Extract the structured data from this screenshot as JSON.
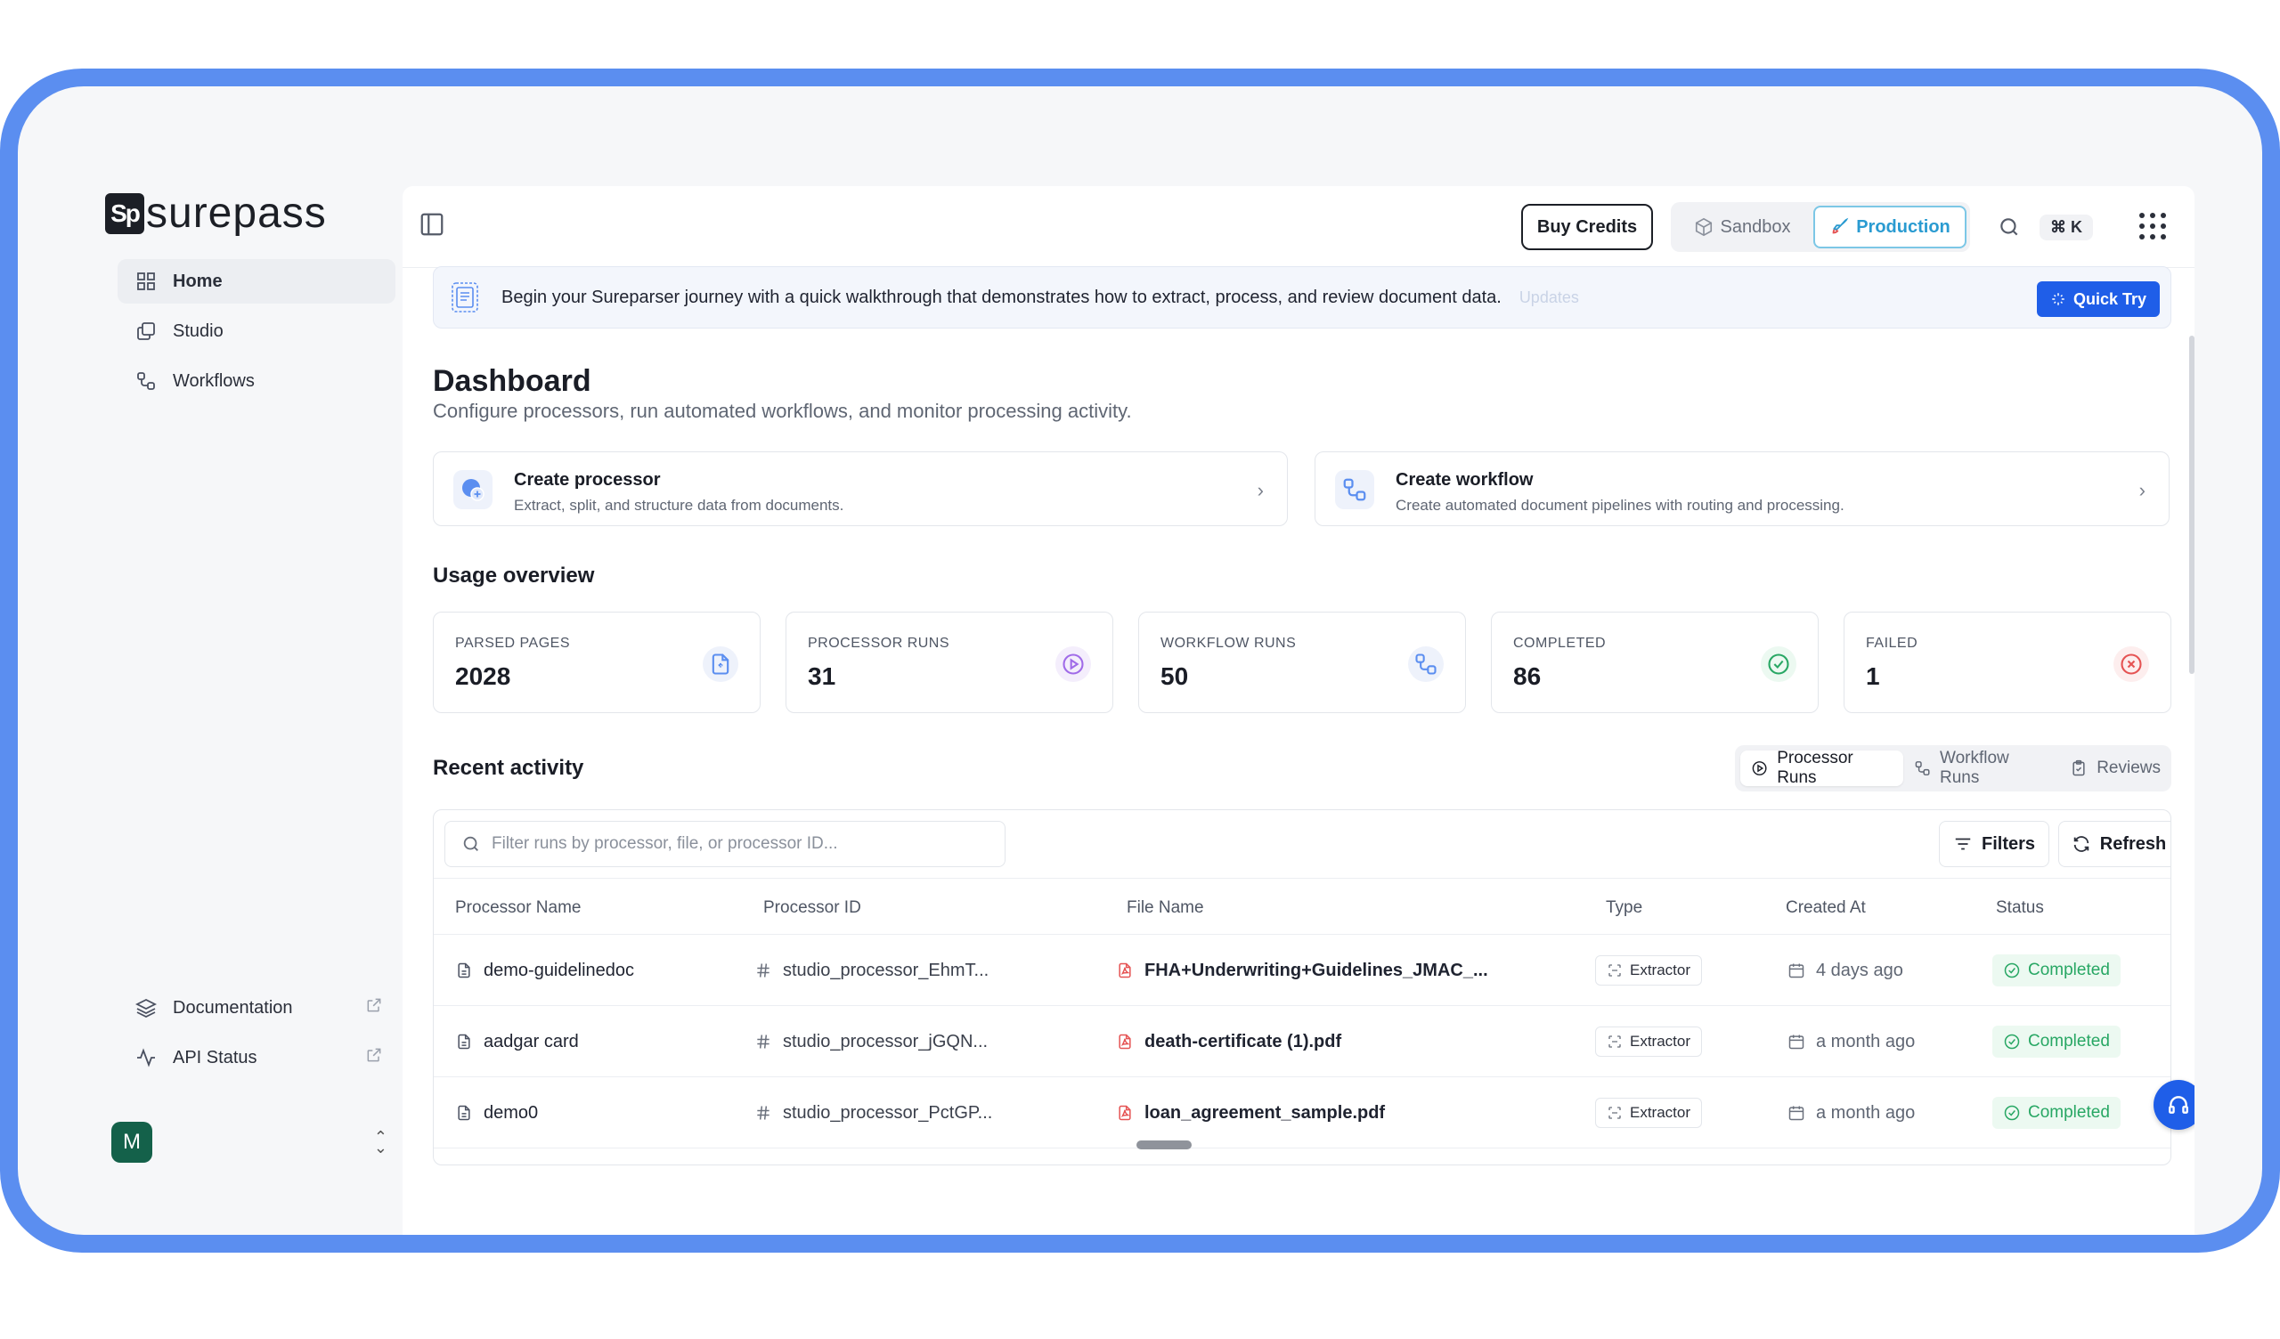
{
  "brand": {
    "mark": "Sp",
    "name": "surepass"
  },
  "sidebar": {
    "items": [
      {
        "label": "Home",
        "icon": "grid-icon",
        "active": true
      },
      {
        "label": "Studio",
        "icon": "copy-icon"
      },
      {
        "label": "Workflows",
        "icon": "workflow-icon"
      }
    ],
    "bottom": [
      {
        "label": "Documentation",
        "icon": "layers-icon"
      },
      {
        "label": "API Status",
        "icon": "activity-icon"
      }
    ],
    "user_initial": "M"
  },
  "topbar": {
    "buy_credits": "Buy Credits",
    "env_sandbox": "Sandbox",
    "env_production": "Production",
    "shortcut": "⌘ K"
  },
  "banner": {
    "text": "Begin your Sureparser journey with a quick walkthrough that demonstrates how to extract, process, and review document data.",
    "faint": "Updates",
    "cta": "Quick Try"
  },
  "dashboard": {
    "title": "Dashboard",
    "subtitle": "Configure processors, run automated workflows, and monitor processing activity."
  },
  "create_cards": [
    {
      "title": "Create processor",
      "desc": "Extract, split, and structure data from documents."
    },
    {
      "title": "Create workflow",
      "desc": "Create automated document pipelines with routing and processing."
    }
  ],
  "usage": {
    "title": "Usage overview",
    "stats": [
      {
        "label": "PARSED PAGES",
        "value": "2028",
        "color": "#5b8ef0"
      },
      {
        "label": "PROCESSOR RUNS",
        "value": "31",
        "color": "#a06be8"
      },
      {
        "label": "WORKFLOW RUNS",
        "value": "50",
        "color": "#5b8ef0"
      },
      {
        "label": "COMPLETED",
        "value": "86",
        "color": "#28a764"
      },
      {
        "label": "FAILED",
        "value": "1",
        "color": "#e55353"
      }
    ]
  },
  "activity": {
    "title": "Recent activity",
    "tabs": [
      "Processor Runs",
      "Workflow Runs",
      "Reviews"
    ],
    "filter_placeholder": "Filter runs by processor, file, or processor ID...",
    "filters_label": "Filters",
    "refresh_label": "Refresh",
    "columns": [
      "Processor Name",
      "Processor ID",
      "File Name",
      "Type",
      "Created At",
      "Status"
    ],
    "rows": [
      {
        "name": "demo-guidelinedoc",
        "id": "studio_processor_EhmT...",
        "file": "FHA+Underwriting+Guidelines_JMAC_...",
        "type": "Extractor",
        "created": "4 days ago",
        "status": "Completed"
      },
      {
        "name": "aadgar card",
        "id": "studio_processor_jGQN...",
        "file": "death-certificate (1).pdf",
        "type": "Extractor",
        "created": "a month ago",
        "status": "Completed"
      },
      {
        "name": "demo0",
        "id": "studio_processor_PctGP...",
        "file": "loan_agreement_sample.pdf",
        "type": "Extractor",
        "created": "a month ago",
        "status": "Completed"
      }
    ]
  }
}
